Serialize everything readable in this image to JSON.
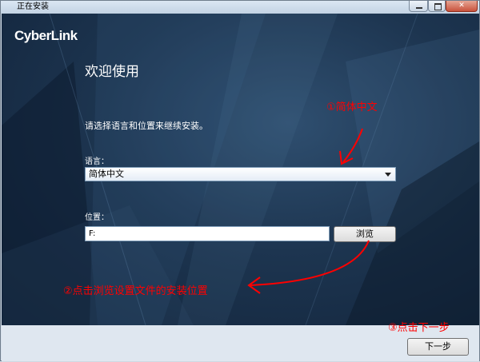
{
  "window": {
    "title": "正在安装",
    "minimize_icon": "minimize-icon",
    "maximize_icon": "maximize-icon",
    "close_icon": "close-icon",
    "close_glyph": "✕"
  },
  "brand": {
    "logo_text": "CyberLink"
  },
  "main": {
    "welcome": "欢迎使用",
    "instruction": "请选择语言和位置来继续安装。",
    "language_label": "语言：",
    "language_value": "简体中文",
    "location_label": "位置：",
    "location_value": "F:",
    "browse_label": "浏览"
  },
  "footer": {
    "next_label": "下一步"
  },
  "annotations": {
    "step1": "①简体中文",
    "step2": "②点击浏览设置文件的安装位置",
    "step3": "③点击下一步",
    "color": "#ff0000"
  },
  "colors": {
    "background_dark": "#11233a",
    "background_mid": "#2f4f70",
    "footer": "#dfe7f0"
  }
}
